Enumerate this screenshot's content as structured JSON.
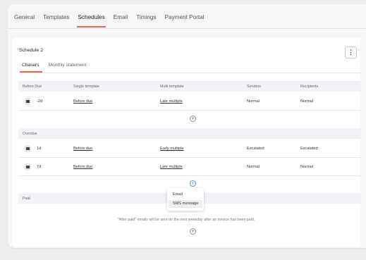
{
  "tabs": [
    "General",
    "Templates",
    "Schedules",
    "Email",
    "Timings",
    "Payment Portal"
  ],
  "active_tab": "Schedules",
  "schedule": {
    "title": "Schedule 2",
    "more_icon": "vertical-ellipsis-icon",
    "subtabs": [
      "Chasers",
      "Monthly statement"
    ]
  },
  "columns": [
    "Before Due",
    "Single template",
    "Multi template",
    "Senders",
    "Recipients"
  ],
  "sections": {
    "before_due": {
      "rows": [
        {
          "days": "-2d",
          "single": "Before due",
          "multi": "Late multiple",
          "senders": "Normal",
          "recipients": "Normal"
        }
      ]
    },
    "overdue": {
      "label": "Overdue",
      "rows": [
        {
          "days": "1d",
          "single": "Before due",
          "multi": "Early multiple",
          "senders": "Escalated",
          "recipients": "Escalated"
        },
        {
          "days": "7d",
          "single": "Before due",
          "multi": "Late multiple",
          "senders": "Normal",
          "recipients": "Normal"
        }
      ]
    },
    "paid": {
      "label": "Paid",
      "note": "\"After paid\" emails will be sent on the next weekday after an invoice has been paid."
    }
  },
  "add_menu": {
    "items": [
      "Email",
      "SMS message"
    ],
    "highlighted": "SMS message"
  },
  "colors": {
    "accent": "#e0675a",
    "link_blue": "#5b8ed6"
  }
}
